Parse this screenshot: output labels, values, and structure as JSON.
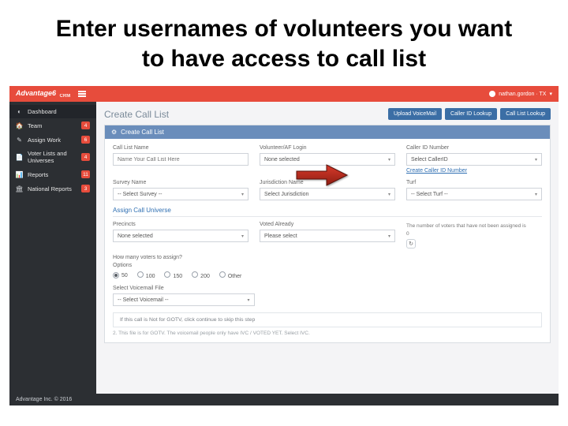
{
  "slide_title": "Enter usernames of volunteers you want to have access to call list",
  "topbar": {
    "logo_main": "Advantage",
    "logo_suffix": "6",
    "logo_sub": "CRM",
    "user": "nathan.gordon · TX",
    "caret": "▾"
  },
  "sidebar": {
    "items": [
      {
        "icon": "◐",
        "label": "Dashboard",
        "badge": ""
      },
      {
        "icon": "🏠",
        "label": "Team",
        "badge": "4"
      },
      {
        "icon": "✎",
        "label": "Assign Work",
        "badge": "6"
      },
      {
        "icon": "📄",
        "label": "Voter Lists and Universes",
        "badge": "4"
      },
      {
        "icon": "📊",
        "label": "Reports",
        "badge": "11"
      },
      {
        "icon": "🏛",
        "label": "National Reports",
        "badge": "3"
      }
    ]
  },
  "header": {
    "title": "Create Call List",
    "buttons": [
      "Upload VoiceMail",
      "Caller ID Lookup",
      "Call List Lookup"
    ]
  },
  "panel": {
    "title": "Create Call List",
    "call_list_name_label": "Call List Name",
    "call_list_name_placeholder": "Name Your Call List Here",
    "volunteer_label": "Volunteer/AF Login",
    "volunteer_value": "None selected",
    "caller_id_label": "Caller ID Number",
    "caller_id_value": "Select CallerID",
    "create_caller_link": "Create Caller ID Number",
    "survey_label": "Survey Name",
    "survey_value": "-- Select Survey --",
    "juris_label": "Jurisdiction Name",
    "juris_value": "Select Jurisdiction",
    "turf_label": "Turf",
    "turf_value": "-- Select Turf --",
    "assign_title": "Assign Call Universe",
    "precincts_label": "Precincts",
    "precincts_value": "None selected",
    "voted_label": "Voted Already",
    "voted_value": "Please select",
    "unassigned_note": "The number of voters that have not been assigned is",
    "unassigned_count": "0",
    "howmany_label": "How many voters to assign?",
    "options_label": "Options",
    "opts": [
      "50",
      "100",
      "150",
      "200",
      "Other"
    ],
    "voicemail_label": "Select Voicemail File",
    "voicemail_value": "-- Select Voicemail --",
    "note1": "If this call is Not for GOTV, click continue to skip this step",
    "note2": "2. This file is for GOTV. The voicemail people only have IVC / VOTED YET. Select IVC."
  },
  "footer": "Advantage Inc. © 2016"
}
